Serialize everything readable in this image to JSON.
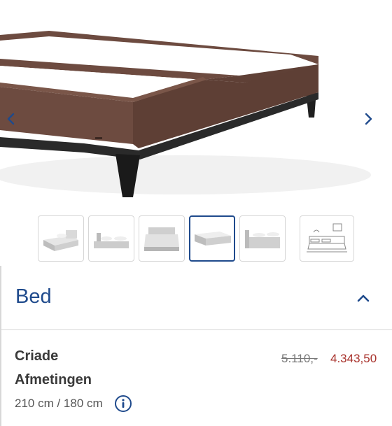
{
  "gallery": {
    "prev_icon": "chevron-left-icon",
    "next_icon": "chevron-right-icon",
    "thumbnails": [
      {
        "icon": "bed-thumbnail-1"
      },
      {
        "icon": "bed-thumbnail-2"
      },
      {
        "icon": "bed-thumbnail-3"
      },
      {
        "icon": "bed-thumbnail-4",
        "active": true
      },
      {
        "icon": "bed-thumbnail-5"
      },
      {
        "icon": "room-sketch-thumbnail"
      }
    ]
  },
  "section": {
    "title": "Bed",
    "toggle_icon": "chevron-up-icon"
  },
  "product": {
    "name": "Criade",
    "price_old": "5.110,-",
    "price_new": "4.343,50",
    "dimensions_label": "Afmetingen",
    "dimensions_value": "210 cm / 180 cm",
    "info_icon": "info-icon"
  },
  "colors": {
    "accent": "#1f4a8c",
    "sale": "#a8312b",
    "frame": "#6a4a40",
    "legs": "#1f1f1f"
  }
}
